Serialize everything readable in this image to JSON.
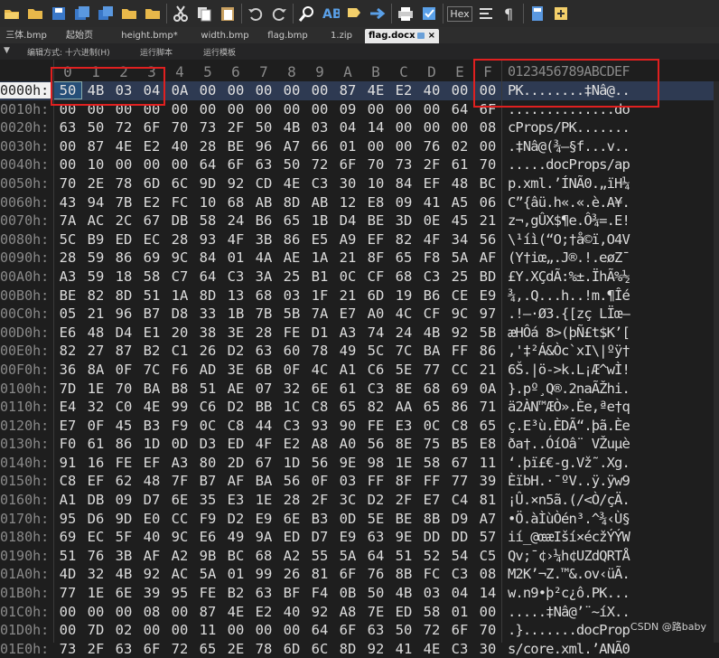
{
  "toolbar": {
    "icons": [
      "folder-open-icon",
      "folder-icon",
      "save-icon",
      "save-as-icon",
      "save-all-icon",
      "folder-icon",
      "folder-icon",
      "cut-icon",
      "copy-icon",
      "paste-icon",
      "undo-icon",
      "redo-icon",
      "find-icon",
      "replace-icon",
      "find-next-icon",
      "goto-icon",
      "print-icon",
      "properties-icon",
      "hex-icon",
      "ruler-icon",
      "paragraph-icon",
      "calculator-icon",
      "template-icon"
    ],
    "hex_label": "Hex"
  },
  "tabs": [
    {
      "label": "三体.bmp",
      "active": false
    },
    {
      "label": "起始页",
      "active": false
    },
    {
      "label": "height.bmp*",
      "active": false
    },
    {
      "label": "width.bmp",
      "active": false
    },
    {
      "label": "flag.bmp",
      "active": false
    },
    {
      "label": "1.zip",
      "active": false
    },
    {
      "label": "flag.docx",
      "active": true
    }
  ],
  "subbar": {
    "edit_mode": "编辑方式: 十六进制(H)",
    "run_script": "运行脚本",
    "run_template": "运行模板"
  },
  "header": {
    "columns": [
      "0",
      "1",
      "2",
      "3",
      "4",
      "5",
      "6",
      "7",
      "8",
      "9",
      "A",
      "B",
      "C",
      "D",
      "E",
      "F"
    ],
    "ascii_header": "0123456789ABCDEF"
  },
  "rows": [
    {
      "addr": "0000h:",
      "bytes": [
        "50",
        "4B",
        "03",
        "04",
        "0A",
        "00",
        "00",
        "00",
        "00",
        "00",
        "87",
        "4E",
        "E2",
        "40",
        "00",
        "00"
      ],
      "ascii": "PK........‡Nâ@.."
    },
    {
      "addr": "0010h:",
      "bytes": [
        "00",
        "00",
        "00",
        "00",
        "00",
        "00",
        "00",
        "00",
        "00",
        "00",
        "09",
        "00",
        "00",
        "00",
        "64",
        "6F"
      ],
      "ascii": "..............do"
    },
    {
      "addr": "0020h:",
      "bytes": [
        "63",
        "50",
        "72",
        "6F",
        "70",
        "73",
        "2F",
        "50",
        "4B",
        "03",
        "04",
        "14",
        "00",
        "00",
        "00",
        "08"
      ],
      "ascii": "cProps/PK......."
    },
    {
      "addr": "0030h:",
      "bytes": [
        "00",
        "87",
        "4E",
        "E2",
        "40",
        "28",
        "BE",
        "96",
        "A7",
        "66",
        "01",
        "00",
        "00",
        "76",
        "02",
        "00"
      ],
      "ascii": ".‡Nâ@(¾–§f...v.."
    },
    {
      "addr": "0040h:",
      "bytes": [
        "00",
        "10",
        "00",
        "00",
        "00",
        "64",
        "6F",
        "63",
        "50",
        "72",
        "6F",
        "70",
        "73",
        "2F",
        "61",
        "70"
      ],
      "ascii": ".....docProps/ap"
    },
    {
      "addr": "0050h:",
      "bytes": [
        "70",
        "2E",
        "78",
        "6D",
        "6C",
        "9D",
        "92",
        "CD",
        "4E",
        "C3",
        "30",
        "10",
        "84",
        "EF",
        "48",
        "BC"
      ],
      "ascii": "p.xml.’ÍNÃ0.„ïH¼"
    },
    {
      "addr": "0060h:",
      "bytes": [
        "43",
        "94",
        "7B",
        "E2",
        "FC",
        "10",
        "68",
        "AB",
        "8D",
        "AB",
        "12",
        "E8",
        "09",
        "41",
        "A5",
        "06"
      ],
      "ascii": "C”{âü.h«.«.è.A¥."
    },
    {
      "addr": "0070h:",
      "bytes": [
        "7A",
        "AC",
        "2C",
        "67",
        "DB",
        "58",
        "24",
        "B6",
        "65",
        "1B",
        "D4",
        "BE",
        "3D",
        "0E",
        "45",
        "21"
      ],
      "ascii": "z¬,gÛX$¶e.Ô¾=.E!"
    },
    {
      "addr": "0080h:",
      "bytes": [
        "5C",
        "B9",
        "ED",
        "EC",
        "28",
        "93",
        "4F",
        "3B",
        "86",
        "E5",
        "A9",
        "EF",
        "82",
        "4F",
        "34",
        "56"
      ],
      "ascii": "\\¹íì(“O;†å©ï‚O4V"
    },
    {
      "addr": "0090h:",
      "bytes": [
        "28",
        "59",
        "86",
        "69",
        "9C",
        "84",
        "01",
        "4A",
        "AE",
        "1A",
        "21",
        "8F",
        "65",
        "F8",
        "5A",
        "AF"
      ],
      "ascii": "(Y†iœ„.J®.!.eøZ¯"
    },
    {
      "addr": "00A0h:",
      "bytes": [
        "A3",
        "59",
        "18",
        "58",
        "C7",
        "64",
        "C3",
        "3A",
        "25",
        "B1",
        "0C",
        "CF",
        "68",
        "C3",
        "25",
        "BD"
      ],
      "ascii": "£Y.XÇdÃ:%±.ÏhÃ%½"
    },
    {
      "addr": "00B0h:",
      "bytes": [
        "BE",
        "82",
        "8D",
        "51",
        "1A",
        "8D",
        "13",
        "68",
        "03",
        "1F",
        "21",
        "6D",
        "19",
        "B6",
        "CE",
        "E9"
      ],
      "ascii": "¾‚.Q...h..!m.¶Îé"
    },
    {
      "addr": "00C0h:",
      "bytes": [
        "05",
        "21",
        "96",
        "B7",
        "D8",
        "33",
        "1B",
        "7B",
        "5B",
        "7A",
        "E7",
        "A0",
        "4C",
        "CF",
        "9C",
        "97"
      ],
      "ascii": ".!–·Ø3.{[zç LÏœ—"
    },
    {
      "addr": "00D0h:",
      "bytes": [
        "E6",
        "48",
        "D4",
        "E1",
        "20",
        "38",
        "3E",
        "28",
        "FE",
        "D1",
        "A3",
        "74",
        "24",
        "4B",
        "92",
        "5B"
      ],
      "ascii": "æHÔá 8>(þÑ£t$K’["
    },
    {
      "addr": "00E0h:",
      "bytes": [
        "82",
        "27",
        "87",
        "B2",
        "C1",
        "26",
        "D2",
        "63",
        "60",
        "78",
        "49",
        "5C",
        "7C",
        "BA",
        "FF",
        "86"
      ],
      "ascii": "‚'‡²Á&Òc`xI\\|ºÿ†"
    },
    {
      "addr": "00F0h:",
      "bytes": [
        "36",
        "8A",
        "0F",
        "7C",
        "F6",
        "AD",
        "3E",
        "6B",
        "0F",
        "4C",
        "A1",
        "C6",
        "5E",
        "77",
        "CC",
        "21"
      ],
      "ascii": "6Š.|ö->k.L¡Æ^wÌ!"
    },
    {
      "addr": "0100h:",
      "bytes": [
        "7D",
        "1E",
        "70",
        "BA",
        "B8",
        "51",
        "AE",
        "07",
        "32",
        "6E",
        "61",
        "C3",
        "8E",
        "68",
        "69",
        "0A"
      ],
      "ascii": "}.pº¸Q®.2naÃŽhi."
    },
    {
      "addr": "0110h:",
      "bytes": [
        "E4",
        "32",
        "C0",
        "4E",
        "99",
        "C6",
        "D2",
        "BB",
        "1C",
        "C8",
        "65",
        "82",
        "AA",
        "65",
        "86",
        "71"
      ],
      "ascii": "ä2ÀN™ÆÒ».Èe‚ªe†q"
    },
    {
      "addr": "0120h:",
      "bytes": [
        "E7",
        "0F",
        "45",
        "B3",
        "F9",
        "0C",
        "C8",
        "44",
        "C3",
        "93",
        "90",
        "FE",
        "E3",
        "0C",
        "C8",
        "65"
      ],
      "ascii": "ç.E³ù.ÈDÃ“.þã.Èe"
    },
    {
      "addr": "0130h:",
      "bytes": [
        "F0",
        "61",
        "86",
        "1D",
        "0D",
        "D3",
        "ED",
        "4F",
        "E2",
        "A8",
        "A0",
        "56",
        "8E",
        "75",
        "B5",
        "E8"
      ],
      "ascii": "ða†..ÓíOâ¨ VŽuµè"
    },
    {
      "addr": "0140h:",
      "bytes": [
        "91",
        "16",
        "FE",
        "EF",
        "A3",
        "80",
        "2D",
        "67",
        "1D",
        "56",
        "9E",
        "98",
        "1E",
        "58",
        "67",
        "11"
      ],
      "ascii": "‘.þï£€-g.Vž˜.Xg."
    },
    {
      "addr": "0150h:",
      "bytes": [
        "C8",
        "EF",
        "62",
        "48",
        "7F",
        "B7",
        "AF",
        "BA",
        "56",
        "0F",
        "03",
        "FF",
        "8F",
        "FF",
        "77",
        "39"
      ],
      "ascii": "ÈïbH.·¯ºV..ÿ.ÿw9"
    },
    {
      "addr": "0160h:",
      "bytes": [
        "A1",
        "DB",
        "09",
        "D7",
        "6E",
        "35",
        "E3",
        "1E",
        "28",
        "2F",
        "3C",
        "D2",
        "2F",
        "E7",
        "C4",
        "81"
      ],
      "ascii": "¡Û.×n5ã.(/<Ò/çÄ."
    },
    {
      "addr": "0170h:",
      "bytes": [
        "95",
        "D6",
        "9D",
        "E0",
        "CC",
        "F9",
        "D2",
        "E9",
        "6E",
        "B3",
        "0D",
        "5E",
        "BE",
        "8B",
        "D9",
        "A7"
      ],
      "ascii": "•Ö.àÌùÒén³.^¾‹Ù§"
    },
    {
      "addr": "0180h:",
      "bytes": [
        "69",
        "EC",
        "5F",
        "40",
        "9C",
        "E6",
        "49",
        "9A",
        "ED",
        "D7",
        "E9",
        "63",
        "9E",
        "DD",
        "DD",
        "57"
      ],
      "ascii": "ií_@œæIší×écžÝÝW"
    },
    {
      "addr": "0190h:",
      "bytes": [
        "51",
        "76",
        "3B",
        "AF",
        "A2",
        "9B",
        "BC",
        "68",
        "A2",
        "55",
        "5A",
        "64",
        "51",
        "52",
        "54",
        "C5"
      ],
      "ascii": "Qv;¯¢›¼h¢UZdQRTÅ"
    },
    {
      "addr": "01A0h:",
      "bytes": [
        "4D",
        "32",
        "4B",
        "92",
        "AC",
        "5A",
        "01",
        "99",
        "26",
        "81",
        "6F",
        "76",
        "8B",
        "FC",
        "C3",
        "08"
      ],
      "ascii": "M2K’¬Z.™&.ov‹üÃ."
    },
    {
      "addr": "01B0h:",
      "bytes": [
        "77",
        "1E",
        "6E",
        "39",
        "95",
        "FE",
        "B2",
        "63",
        "BF",
        "F4",
        "0B",
        "50",
        "4B",
        "03",
        "04",
        "14"
      ],
      "ascii": "w.n9•þ²c¿ô.PK..."
    },
    {
      "addr": "01C0h:",
      "bytes": [
        "00",
        "00",
        "00",
        "08",
        "00",
        "87",
        "4E",
        "E2",
        "40",
        "92",
        "A8",
        "7E",
        "ED",
        "58",
        "01",
        "00"
      ],
      "ascii": ".....‡Nâ@’¨~íX.."
    },
    {
      "addr": "01D0h:",
      "bytes": [
        "00",
        "7D",
        "02",
        "00",
        "00",
        "11",
        "00",
        "00",
        "00",
        "64",
        "6F",
        "63",
        "50",
        "72",
        "6F",
        "70"
      ],
      "ascii": ".}.......docProp"
    },
    {
      "addr": "01E0h:",
      "bytes": [
        "73",
        "2F",
        "63",
        "6F",
        "72",
        "65",
        "2E",
        "78",
        "6D",
        "6C",
        "8D",
        "92",
        "41",
        "4E",
        "C3",
        "30"
      ],
      "ascii": "s/core.xml.’ANÃ0"
    }
  ],
  "watermark": "CSDN @路baby",
  "colors": {
    "highlight_box": "#e02020",
    "selection": "#264f78"
  }
}
